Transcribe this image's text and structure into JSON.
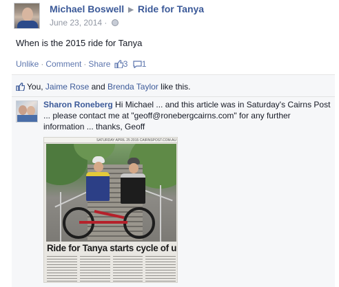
{
  "post": {
    "author": "Michael Boswell",
    "target": "Ride for Tanya",
    "date": "June 23, 2014 ·",
    "text": "When is the 2015 ride for Tanya"
  },
  "actions": {
    "unlike": "Unlike",
    "comment": "Comment",
    "share": "Share",
    "like_count": "3",
    "comment_count": "1"
  },
  "likes": {
    "you": "You",
    "sep1": ", ",
    "person1": "Jaime Rose",
    "and": " and ",
    "person2": "Brenda Taylor",
    "suffix": " like this."
  },
  "comment": {
    "author": "Sharon Roneberg",
    "text": " Hi Michael ... and this article was in Saturday's Cairns Post ... please contact me at \"geoff@ronebergcairns.com\" for any further information ... thanks, Geoff"
  },
  "clipping": {
    "header": "SATURDAY APRIL 25 2015 CAIRNSPOST.COM.AU",
    "headline": "Ride for Tanya starts cycle of upgrading"
  },
  "colors": {
    "link": "#3b5998",
    "action_link": "#5c75ad",
    "meta": "#9197a3",
    "comment_bg": "#f6f7f9"
  },
  "icons": {
    "separator": "triangle-right-icon",
    "privacy": "globe-icon",
    "like": "thumbs-up-icon",
    "comment": "speech-bubble-icon"
  }
}
